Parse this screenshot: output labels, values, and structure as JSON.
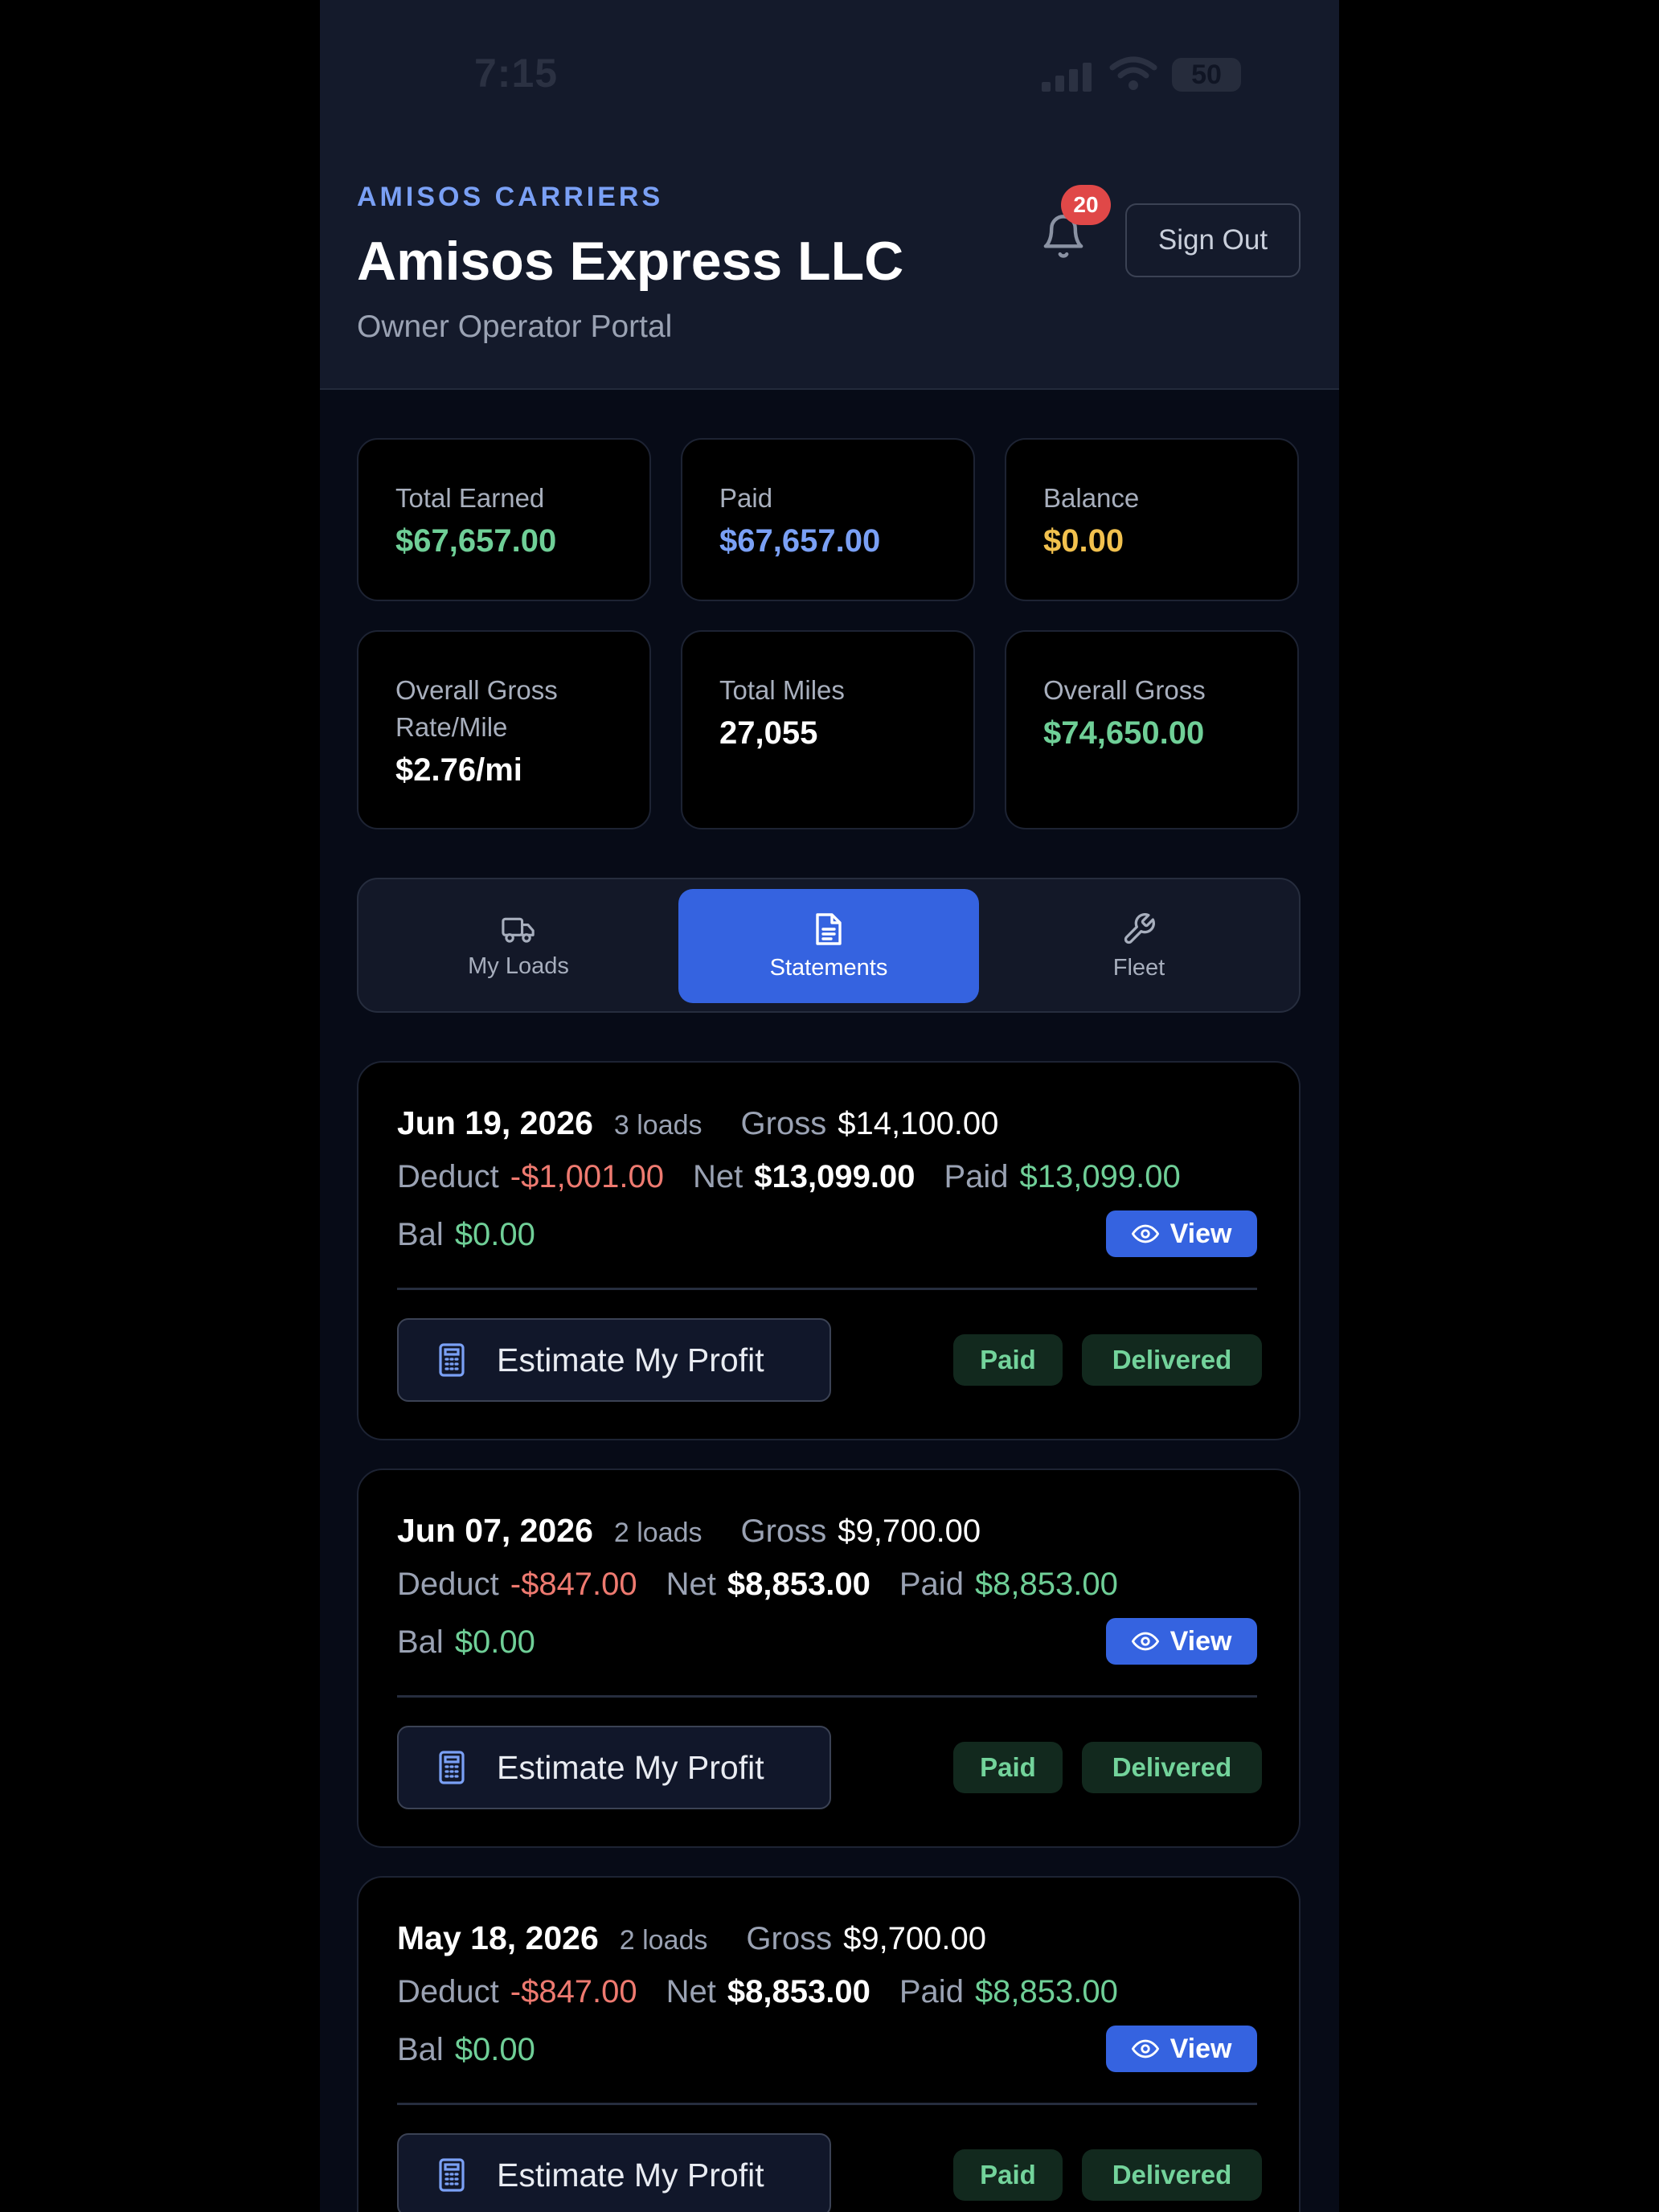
{
  "status_bar": {
    "time": "7:15",
    "battery": "50"
  },
  "header": {
    "brand": "AMISOS CARRIERS",
    "company": "Amisos Express LLC",
    "subtitle": "Owner Operator Portal",
    "notification_count": "20",
    "sign_out_label": "Sign Out"
  },
  "stats": [
    {
      "label": "Total Earned",
      "value": "$67,657.00",
      "color": "#6fcf97"
    },
    {
      "label": "Paid",
      "value": "$67,657.00",
      "color": "#7aa0f5"
    },
    {
      "label": "Balance",
      "value": "$0.00",
      "color": "#f2c14e"
    },
    {
      "label": "Overall Gross Rate/Mile",
      "value": "$2.76/mi",
      "color": "#ffffff"
    },
    {
      "label": "Total Miles",
      "value": "27,055",
      "color": "#ffffff"
    },
    {
      "label": "Overall Gross",
      "value": "$74,650.00",
      "color": "#6fcf97"
    }
  ],
  "tabs": [
    {
      "label": "My Loads",
      "icon": "truck-icon",
      "active": false
    },
    {
      "label": "Statements",
      "icon": "document-icon",
      "active": true
    },
    {
      "label": "Fleet",
      "icon": "wrench-icon",
      "active": false
    }
  ],
  "labels": {
    "gross": "Gross",
    "deduct": "Deduct",
    "net": "Net",
    "paid": "Paid",
    "bal": "Bal",
    "view": "View",
    "estimate": "Estimate My Profit"
  },
  "statements": [
    {
      "date": "Jun 19, 2026",
      "loads": "3 loads",
      "gross": "$14,100.00",
      "deduct": "-$1,001.00",
      "net": "$13,099.00",
      "paid": "$13,099.00",
      "bal": "$0.00",
      "status_paid": "Paid",
      "status_delivery": "Delivered"
    },
    {
      "date": "Jun 07, 2026",
      "loads": "2 loads",
      "gross": "$9,700.00",
      "deduct": "-$847.00",
      "net": "$8,853.00",
      "paid": "$8,853.00",
      "bal": "$0.00",
      "status_paid": "Paid",
      "status_delivery": "Delivered"
    },
    {
      "date": "May 18, 2026",
      "loads": "2 loads",
      "gross": "$9,700.00",
      "deduct": "-$847.00",
      "net": "$8,853.00",
      "paid": "$8,853.00",
      "bal": "$0.00",
      "status_paid": "Paid",
      "status_delivery": "Delivered"
    }
  ],
  "colors": {
    "accent": "#3563e0",
    "green": "#6fcf97",
    "red": "#ee7a70",
    "badge": "#e04848"
  }
}
